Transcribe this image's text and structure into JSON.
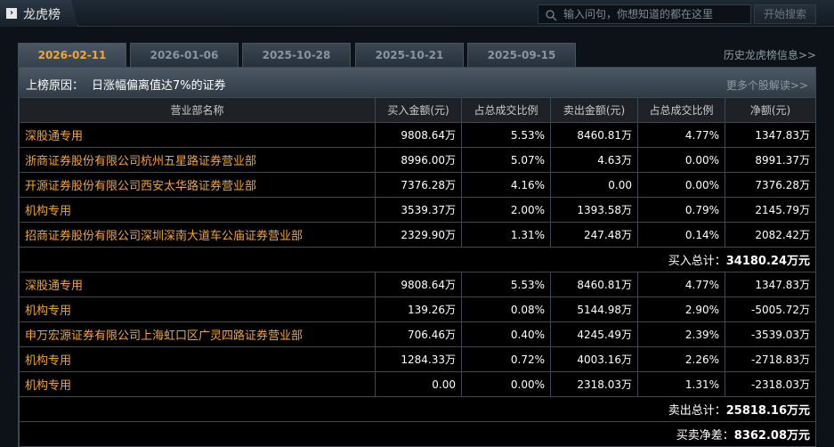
{
  "window": {
    "title": "龙虎榜"
  },
  "search": {
    "placeholder": "输入问句，你想知道的都在这里",
    "button": "开始搜索"
  },
  "tabs": [
    "2026-02-11",
    "2026-01-06",
    "2025-10-28",
    "2025-10-21",
    "2025-09-15"
  ],
  "history_link": "历史龙虎榜信息>>",
  "reason": {
    "label": "上榜原因：",
    "text": "日涨幅偏离值达7%的证券",
    "more": "更多个股解读>>"
  },
  "columns": [
    "营业部名称",
    "买入金额(元)",
    "占总成交比例",
    "卖出金额(元)",
    "占总成交比例",
    "净额(元)"
  ],
  "buy_rows": [
    [
      "深股通专用",
      "9808.64万",
      "5.53%",
      "8460.81万",
      "4.77%",
      "1347.83万"
    ],
    [
      "浙商证券股份有限公司杭州五星路证券营业部",
      "8996.00万",
      "5.07%",
      "4.63万",
      "0.00%",
      "8991.37万"
    ],
    [
      "开源证券股份有限公司西安太华路证券营业部",
      "7376.28万",
      "4.16%",
      "0.00",
      "0.00%",
      "7376.28万"
    ],
    [
      "机构专用",
      "3539.37万",
      "2.00%",
      "1393.58万",
      "0.79%",
      "2145.79万"
    ],
    [
      "招商证券股份有限公司深圳深南大道车公庙证券营业部",
      "2329.90万",
      "1.31%",
      "247.48万",
      "0.14%",
      "2082.42万"
    ]
  ],
  "buy_total": {
    "label": "买入总计：",
    "value": "34180.24万元"
  },
  "sell_rows": [
    [
      "深股通专用",
      "9808.64万",
      "5.53%",
      "8460.81万",
      "4.77%",
      "1347.83万"
    ],
    [
      "机构专用",
      "139.26万",
      "0.08%",
      "5144.98万",
      "2.90%",
      "-5005.72万"
    ],
    [
      "申万宏源证券有限公司上海虹口区广灵四路证券营业部",
      "706.46万",
      "0.40%",
      "4245.49万",
      "2.39%",
      "-3539.03万"
    ],
    [
      "机构专用",
      "1284.33万",
      "0.72%",
      "4003.16万",
      "2.26%",
      "-2718.83万"
    ],
    [
      "机构专用",
      "0.00",
      "0.00%",
      "2318.03万",
      "1.31%",
      "-2318.03万"
    ]
  ],
  "sell_total": {
    "label": "卖出总计：",
    "value": "25818.16万元"
  },
  "net_total": {
    "label": "买卖净差：",
    "value": "8362.08万元"
  },
  "colors": {
    "accent": "#f3a534",
    "header_bg": "#1e2227",
    "panel_bg": "#000000"
  }
}
